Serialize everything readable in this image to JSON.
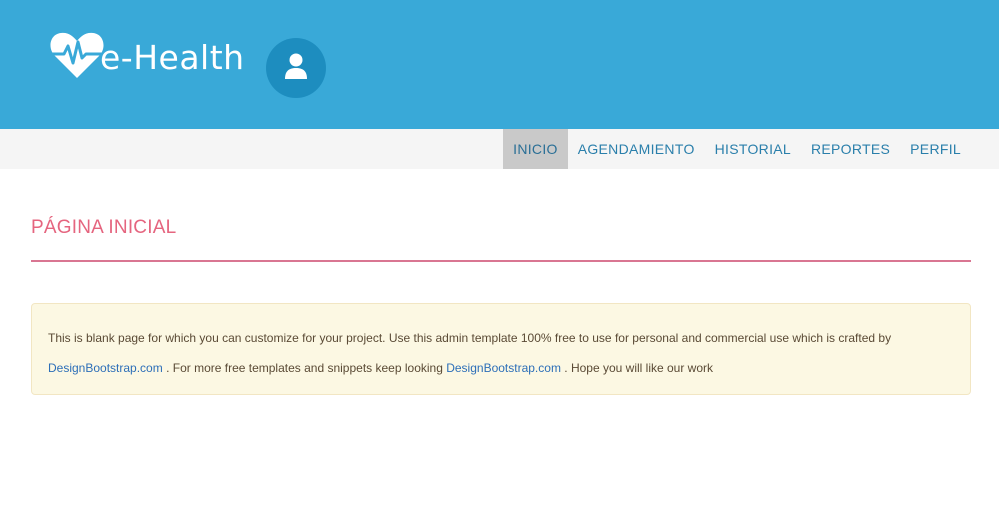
{
  "header": {
    "logo_text": "e-Health",
    "logo_icon": "heart-pulse-icon",
    "avatar_icon": "user-icon",
    "background": "#39a9d8"
  },
  "nav": {
    "items": [
      {
        "label": "INICIO",
        "active": true
      },
      {
        "label": "AGENDAMIENTO",
        "active": false
      },
      {
        "label": "HISTORIAL",
        "active": false
      },
      {
        "label": "REPORTES",
        "active": false
      },
      {
        "label": "PERFIL",
        "active": false
      }
    ]
  },
  "page": {
    "title": "PÁGINA INICIAL",
    "title_color": "#e5657f"
  },
  "alert": {
    "text_1": "This is blank page for which you can customize for your project. Use this admin template 100% free to use for personal and commercial use which is crafted by",
    "link_1": "DesignBootstrap.com",
    "text_2": " . For more free templates and snippets keep looking ",
    "link_2": "DesignBootstrap.com",
    "text_3": " . Hope you will like our work",
    "background": "#fcf8e3"
  }
}
